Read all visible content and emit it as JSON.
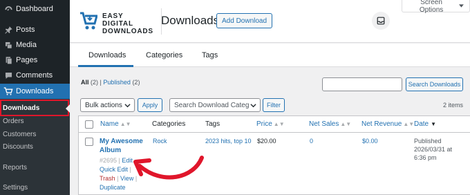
{
  "sidebar": {
    "items": [
      {
        "label": "Dashboard",
        "icon": "dashboard-icon"
      },
      {
        "label": "Posts",
        "icon": "pin-icon"
      },
      {
        "label": "Media",
        "icon": "media-icon"
      },
      {
        "label": "Pages",
        "icon": "pages-icon"
      },
      {
        "label": "Comments",
        "icon": "comment-icon"
      },
      {
        "label": "Downloads",
        "icon": "cart-icon"
      }
    ],
    "submenu": [
      "Downloads",
      "Orders",
      "Customers",
      "Discounts",
      "Reports",
      "Settings"
    ]
  },
  "header": {
    "logo_lines": [
      "EASY",
      "DIGITAL",
      "DOWNLOADS"
    ],
    "title": "Downloads",
    "add_button": "Add Download",
    "screen_options": "Screen Options"
  },
  "tabs": [
    "Downloads",
    "Categories",
    "Tags"
  ],
  "filters": {
    "view_all": "All",
    "view_all_count": "(2)",
    "view_published": "Published",
    "view_published_count": "(2)",
    "search_button": "Search Downloads",
    "bulk_actions": "Bulk actions",
    "apply": "Apply",
    "category_select": "Search Download Categ",
    "filter": "Filter",
    "items_count": "2 items"
  },
  "table": {
    "columns": [
      "Name",
      "Categories",
      "Tags",
      "Price",
      "Net Sales",
      "Net Revenue",
      "Date"
    ],
    "row": {
      "name": "My Awesome Album",
      "id": "#2695",
      "actions": [
        "Edit",
        "Quick Edit",
        "Trash",
        "View",
        "Duplicate"
      ],
      "category": "Rock",
      "tags": "2023 hits, top 10",
      "price": "$20.00",
      "net_sales": "0",
      "net_revenue": "$0.00",
      "date_status": "Published",
      "date_value": "2026/03/31 at",
      "date_time": "6:36 pm"
    }
  },
  "colors": {
    "admin_bar": "#1d2327",
    "accent": "#2271b1",
    "highlight": "#e0162b",
    "trash": "#b32d2e"
  }
}
